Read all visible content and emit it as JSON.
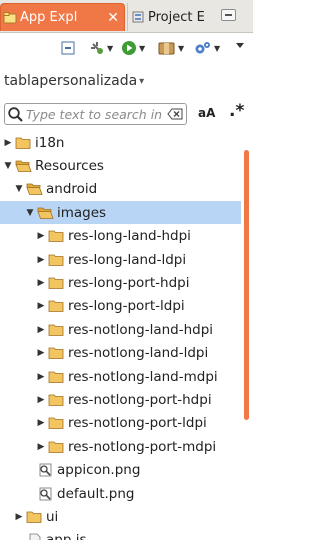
{
  "tabs": {
    "active": {
      "label": "App Expl",
      "close": "✕"
    },
    "inactive": {
      "label": "Project E"
    }
  },
  "toolbar": {
    "buttons": [
      "collapse-all-icon",
      "new-item-icon",
      "run-icon",
      "package-icon",
      "settings-icon"
    ],
    "menu_icon": "chevron-down-icon"
  },
  "project": {
    "name": "tablapersonalizada"
  },
  "search": {
    "placeholder": "Type text to search in",
    "case_label": "aA",
    "regex_label": ".*"
  },
  "colors": {
    "accent": "#f07746",
    "folder": "#f3c560",
    "selection": "#b8d5f5"
  },
  "tree": [
    {
      "label": "i18n",
      "expanded": false,
      "type": "folder"
    },
    {
      "label": "Resources",
      "expanded": true,
      "type": "folder"
    },
    {
      "label": "android",
      "expanded": true,
      "type": "folder"
    },
    {
      "label": "images",
      "expanded": true,
      "type": "folder",
      "selected": true
    },
    {
      "label": "res-long-land-hdpi",
      "expanded": false,
      "type": "folder"
    },
    {
      "label": "res-long-land-ldpi",
      "expanded": false,
      "type": "folder"
    },
    {
      "label": "res-long-port-hdpi",
      "expanded": false,
      "type": "folder"
    },
    {
      "label": "res-long-port-ldpi",
      "expanded": false,
      "type": "folder"
    },
    {
      "label": "res-notlong-land-hdpi",
      "expanded": false,
      "type": "folder"
    },
    {
      "label": "res-notlong-land-ldpi",
      "expanded": false,
      "type": "folder"
    },
    {
      "label": "res-notlong-land-mdpi",
      "expanded": false,
      "type": "folder"
    },
    {
      "label": "res-notlong-port-hdpi",
      "expanded": false,
      "type": "folder"
    },
    {
      "label": "res-notlong-port-ldpi",
      "expanded": false,
      "type": "folder"
    },
    {
      "label": "res-notlong-port-mdpi",
      "expanded": false,
      "type": "folder"
    },
    {
      "label": "appicon.png",
      "type": "image"
    },
    {
      "label": "default.png",
      "type": "image"
    },
    {
      "label": "ui",
      "expanded": false,
      "type": "folder"
    },
    {
      "label": "app.js",
      "type": "file"
    }
  ]
}
